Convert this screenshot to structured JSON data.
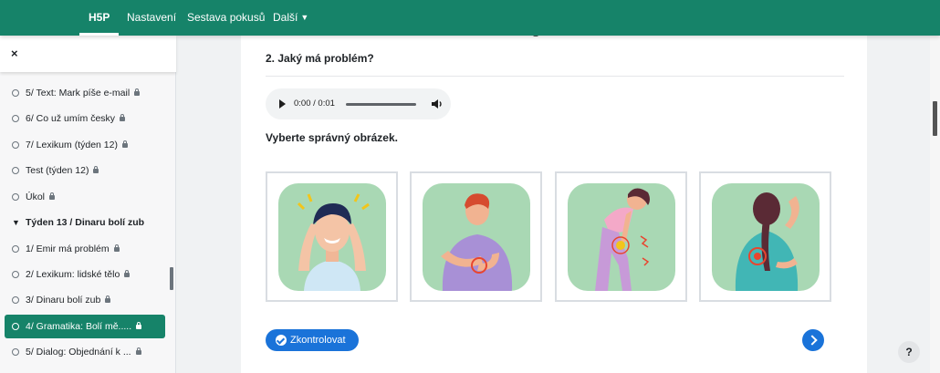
{
  "nav": {
    "items": [
      {
        "label": "H5P",
        "active": true
      },
      {
        "label": "Nastavení"
      },
      {
        "label": "Sestava pokusů"
      },
      {
        "label": "Další"
      }
    ]
  },
  "sidebar": {
    "close_icon": "×",
    "items": [
      {
        "label": "5/ Text: Mark píše e-mail",
        "locked": true
      },
      {
        "label": "6/ Co už umím česky",
        "locked": true
      },
      {
        "label": "7/ Lexikum (týden 12)",
        "locked": true
      },
      {
        "label": "Test (týden 12)",
        "locked": true
      },
      {
        "label": "Úkol",
        "locked": true
      },
      {
        "label": "Týden 13 / Dinaru bolí zub",
        "section": true
      },
      {
        "label": "1/ Emir má problém",
        "locked": true
      },
      {
        "label": "2/ Lexikum: lidské tělo",
        "locked": true
      },
      {
        "label": "3/ Dinaru bolí zub",
        "locked": true
      },
      {
        "label": "4/ Gramatika: Bolí mě.....",
        "locked": true,
        "active": true
      },
      {
        "label": "5/ Dialog: Objednání k ...",
        "locked": true
      }
    ]
  },
  "question": {
    "title": "2. Jaký má problém?",
    "audio_time": "0:00 / 0:01",
    "instruction": "Vyberte správný obrázek.",
    "choices": [
      {
        "icon": "headache-image"
      },
      {
        "icon": "stomachache-image"
      },
      {
        "icon": "knee-pain-image"
      },
      {
        "icon": "back-pain-image"
      }
    ],
    "check_label": "Zkontrolovat"
  },
  "help_label": "?",
  "colors": {
    "brand": "#168369",
    "accent": "#1a73d9",
    "tile": "#a9d8b4"
  }
}
